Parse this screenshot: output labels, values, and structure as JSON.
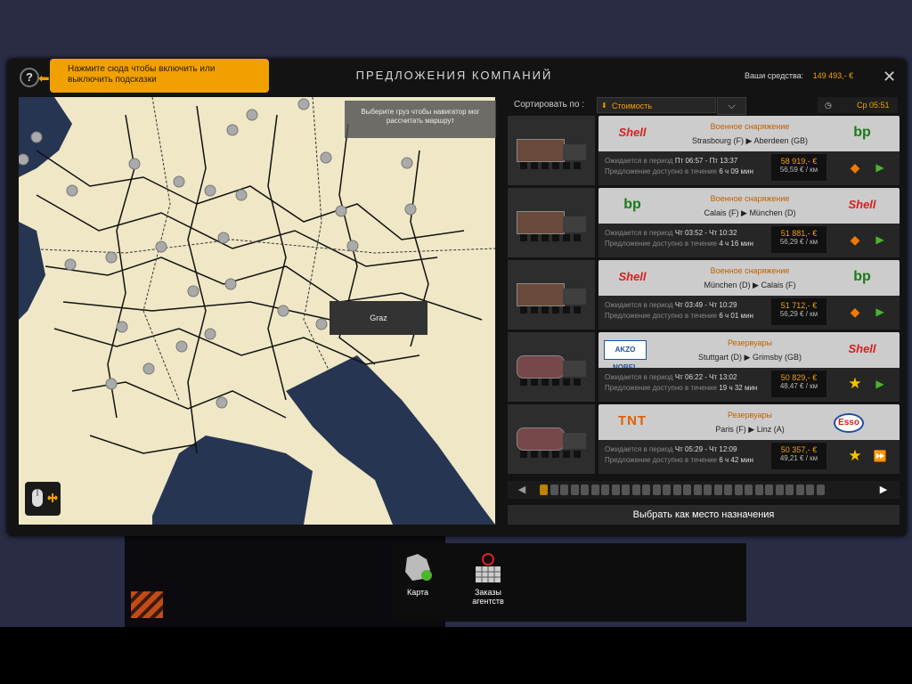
{
  "header": {
    "title": "ПРЕДЛОЖЕНИЯ КОМПАНИЙ",
    "funds_label": "Ваши средства:",
    "funds_value": "149 493,- €",
    "close_icon": "close-icon"
  },
  "tooltip": {
    "text": "Нажмите сюда чтобы включить или выключить подсказки"
  },
  "map": {
    "hint": "Выберите груз чтобы навигатор мог рассчитать маршрут",
    "city_label": "Graz"
  },
  "sort": {
    "label": "Сортировать по :",
    "selected": "Стоимость"
  },
  "clock": {
    "time": "Ср 05:51"
  },
  "offers": [
    {
      "source_logo": "Shell",
      "dest_logo": "bp",
      "cargo": "Военное снаряжение",
      "route": "Strasbourg (F) ▶ Aberdeen (GB)",
      "period_label": "Ожидается в период",
      "period": "Пт 06:57 - Пт 13:37",
      "avail_label": "Предложение доступно в течение",
      "avail": "6 ч 09 мин",
      "total": "58 919,- €",
      "rate": "56,59 € / км",
      "status_icon": "hazard-icon"
    },
    {
      "source_logo": "bp",
      "dest_logo": "Shell",
      "cargo": "Военное снаряжение",
      "route": "Calais (F) ▶ München (D)",
      "period_label": "Ожидается в период",
      "period": "Чт 03:52 - Чт 10:32",
      "avail_label": "Предложение доступно в течение",
      "avail": "4 ч 16 мин",
      "total": "51 881,- €",
      "rate": "56,29 € / км",
      "status_icon": "hazard-icon"
    },
    {
      "source_logo": "Shell",
      "dest_logo": "bp",
      "cargo": "Военное снаряжение",
      "route": "München (D) ▶ Calais (F)",
      "period_label": "Ожидается в период",
      "period": "Чт 03:49 - Чт 10:29",
      "avail_label": "Предложение доступно в течение",
      "avail": "6 ч 01 мин",
      "total": "51 712,- €",
      "rate": "56,29 € / км",
      "status_icon": "hazard-icon"
    },
    {
      "source_logo": "AKZO NOBEL",
      "dest_logo": "Shell",
      "cargo": "Резервуары",
      "route": "Stuttgart (D) ▶ Grimsby (GB)",
      "period_label": "Ожидается в период",
      "period": "Чт 06:22 - Чт 13:02",
      "avail_label": "Предложение доступно в течение",
      "avail": "19 ч 32 мин",
      "total": "50 829,- €",
      "rate": "48,47 € / км",
      "status_icon": "star-icon"
    },
    {
      "source_logo": "TNT",
      "dest_logo": "Esso",
      "cargo": "Резервуары",
      "route": "Paris (F) ▶ Linz (A)",
      "period_label": "Ожидается в период",
      "period": "Чт 05:29 - Чт 12:09",
      "avail_label": "Предложение доступно в течение",
      "avail": "6 ч 42 мин",
      "total": "50 357,- €",
      "rate": "49,21 € / км",
      "status_icon": "star-icon"
    }
  ],
  "pager": {
    "current_page": 1,
    "total_pages": 28
  },
  "actions": {
    "select_destination": "Выбрать как место назначения"
  },
  "bottom_nav": {
    "map_label": "Карта",
    "agency_label_1": "Заказы",
    "agency_label_2": "агентств"
  }
}
